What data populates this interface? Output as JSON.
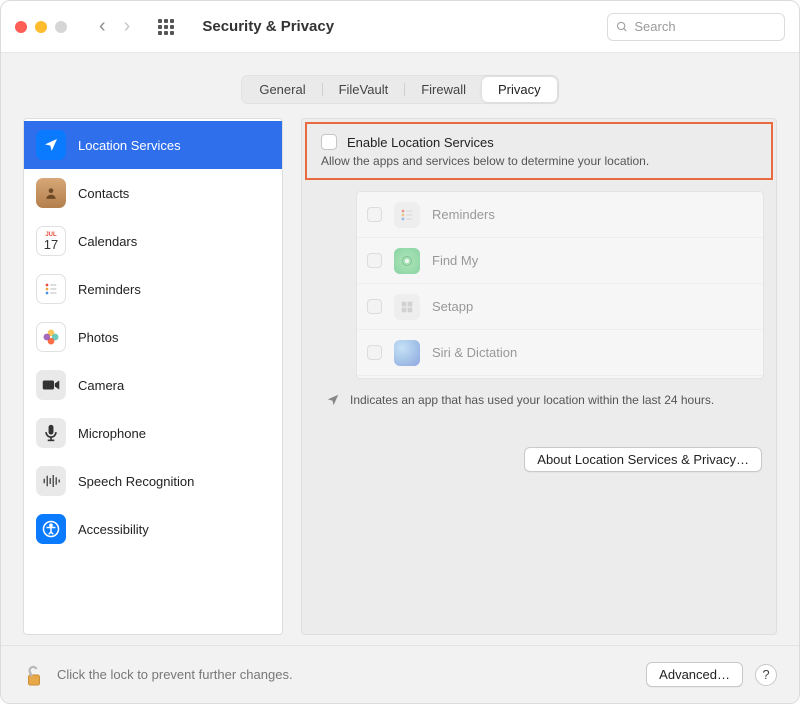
{
  "header": {
    "title": "Security & Privacy",
    "search_placeholder": "Search"
  },
  "tabs": {
    "general": "General",
    "filevault": "FileVault",
    "firewall": "Firewall",
    "privacy": "Privacy",
    "active": "privacy"
  },
  "sidebar": {
    "items": [
      {
        "id": "location-services",
        "label": "Location Services",
        "selected": true
      },
      {
        "id": "contacts",
        "label": "Contacts"
      },
      {
        "id": "calendars",
        "label": "Calendars"
      },
      {
        "id": "reminders",
        "label": "Reminders"
      },
      {
        "id": "photos",
        "label": "Photos"
      },
      {
        "id": "camera",
        "label": "Camera"
      },
      {
        "id": "microphone",
        "label": "Microphone"
      },
      {
        "id": "speech-recognition",
        "label": "Speech Recognition"
      },
      {
        "id": "accessibility",
        "label": "Accessibility"
      }
    ]
  },
  "calendar_icon": {
    "month": "JUL",
    "day": "17"
  },
  "pane": {
    "enable_label": "Enable Location Services",
    "enable_sub": "Allow the apps and services below to determine your location.",
    "apps": [
      {
        "id": "reminders",
        "label": "Reminders"
      },
      {
        "id": "find-my",
        "label": "Find My"
      },
      {
        "id": "setapp",
        "label": "Setapp"
      },
      {
        "id": "siri-dictation",
        "label": "Siri & Dictation"
      }
    ],
    "usage_note": "Indicates an app that has used your location within the last 24 hours.",
    "about_button": "About Location Services & Privacy…"
  },
  "footer": {
    "lock_text": "Click the lock to prevent further changes.",
    "advanced": "Advanced…",
    "help": "?"
  },
  "colors": {
    "accent": "#2f6fec",
    "highlight": "#e86a3e"
  }
}
